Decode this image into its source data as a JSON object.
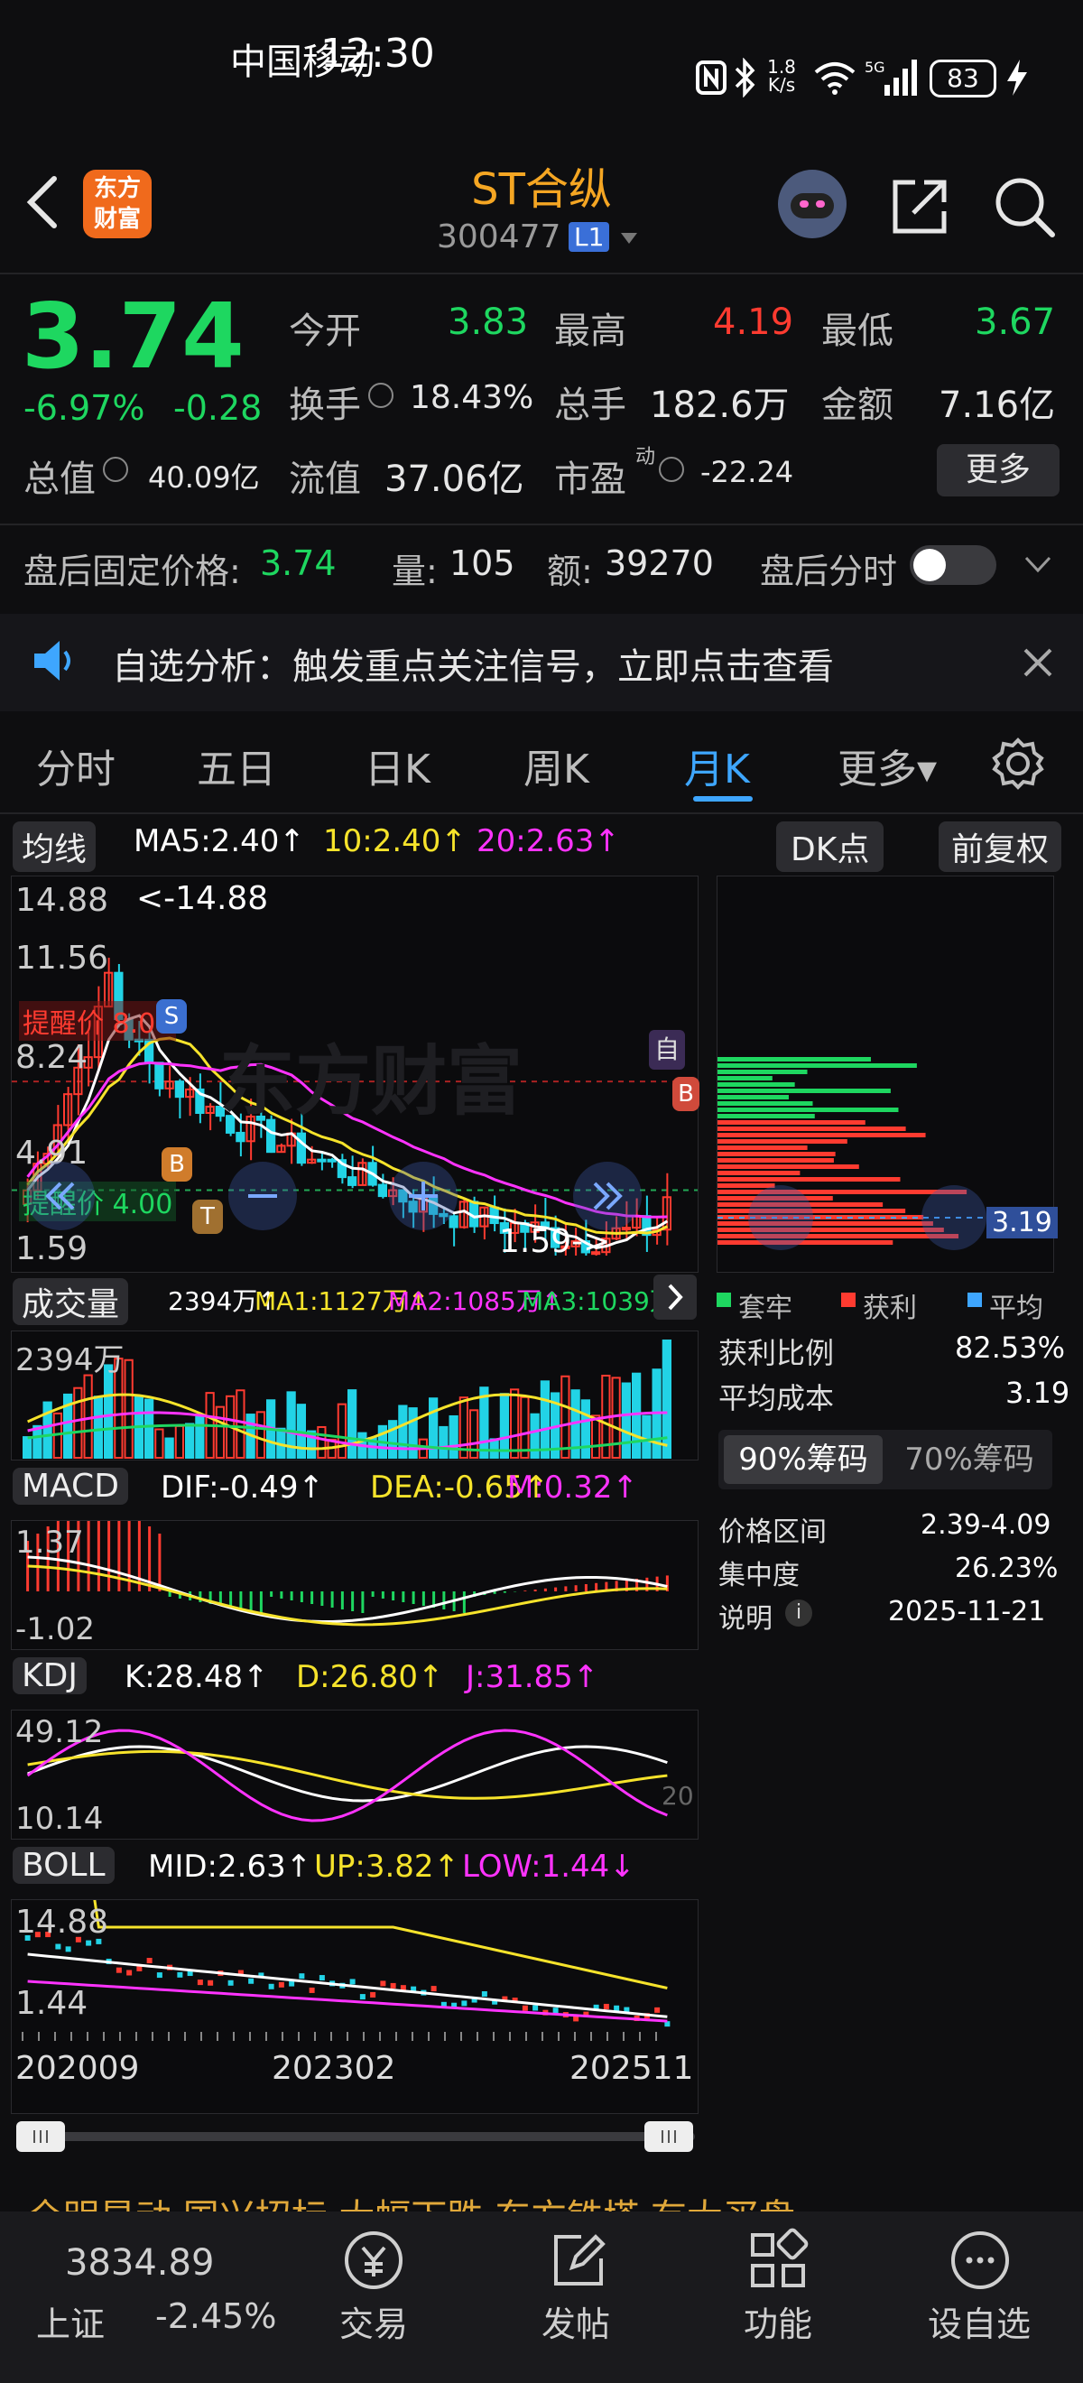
{
  "status_bar": {
    "carrier": "中国移动",
    "time": "12:30",
    "net_speed_top": "1.8",
    "net_speed_bottom": "K/s",
    "battery": "83"
  },
  "header": {
    "logo_line1": "东方",
    "logo_line2": "财富",
    "title": "ST合纵",
    "code": "300477",
    "level": "L1"
  },
  "quote": {
    "price": "3.74",
    "change_pct": "-6.97%",
    "change_abs": "-0.28",
    "open_label": "今开",
    "open": "3.83",
    "high_label": "最高",
    "high": "4.19",
    "low_label": "最低",
    "low": "3.67",
    "turnover_label": "换手",
    "turnover": "18.43%",
    "volume_label": "总手",
    "volume": "182.6万",
    "amount_label": "金额",
    "amount": "7.16亿",
    "mktcap_label": "总值",
    "mktcap": "40.09亿",
    "float_label": "流值",
    "float_cap": "37.06亿",
    "pe_label": "市盈",
    "pe_sup": "动",
    "pe": "-22.24",
    "more_btn": "更多"
  },
  "after_hours": {
    "label": "盘后固定价格:",
    "price": "3.74",
    "vol_label": "量:",
    "vol": "105",
    "amt_label": "额:",
    "amt": "39270",
    "toggle_label": "盘后分时"
  },
  "notice": {
    "text": "自选分析：触发重点关注信号，立即点击查看"
  },
  "tabs": [
    "分时",
    "五日",
    "日K",
    "周K",
    "月K",
    "更多▾"
  ],
  "active_tab": "月K",
  "main_chart": {
    "indicator": "均线",
    "ma5": "MA5:2.40↑",
    "ma10": "10:2.40↑",
    "ma20": "20:2.63↑",
    "dk_btn": "DK点",
    "fq_btn": "前复权",
    "y_labels": [
      "14.88",
      "11.56",
      "8.24",
      "4.91",
      "1.59"
    ],
    "max_marker": "<-14.88",
    "min_marker": "1.59->",
    "alert_high": "提醒价 8.00",
    "alert_low": "提醒价 4.00",
    "watermark": "东方财富",
    "self_tag": "自"
  },
  "volume_chart": {
    "indicator": "成交量",
    "val": "2394万↑",
    "ma1": "MA1:1127万↑",
    "ma2": "MA2:1085万↑",
    "ma3": "MA3:1039万↑",
    "y_top": "2394万"
  },
  "macd_chart": {
    "indicator": "MACD",
    "dif": "DIF:-0.49↑",
    "dea": "DEA:-0.65↑",
    "m": "M:0.32↑",
    "y_top": "1.37",
    "y_bottom": "-1.02"
  },
  "kdj_chart": {
    "indicator": "KDJ",
    "k": "K:28.48↑",
    "d": "D:26.80↑",
    "j": "J:31.85↑",
    "y_top": "49.12",
    "y_bottom": "10.14",
    "right_label": "20"
  },
  "boll_chart": {
    "indicator": "BOLL",
    "mid": "MID:2.63↑",
    "up": "UP:3.82↑",
    "low": "LOW:1.44↓",
    "y_top": "14.88",
    "y_bottom": "1.44"
  },
  "x_axis": [
    "202009",
    "202302",
    "202511"
  ],
  "chip_panel": {
    "avg_cost_tag": "3.19",
    "legend": [
      "套牢",
      "获利",
      "平均"
    ],
    "rows": [
      [
        "获利比例",
        "82.53%"
      ],
      [
        "平均成本",
        "3.19"
      ]
    ],
    "tab_active": "90%筹码",
    "tab_other": "70%筹码",
    "rows2": [
      [
        "价格区间",
        "2.39-4.09"
      ],
      [
        "集中度",
        "26.23%"
      ],
      [
        "说明",
        "2025-11-21"
      ]
    ]
  },
  "ticker": {
    "text": "全明星动 国兴招标 大幅下跌 东方铁塔 有大买盘"
  },
  "bottom_nav": {
    "index_value": "3834.89",
    "index_name": "上证",
    "index_change": "-2.45%",
    "items": [
      "交易",
      "发帖",
      "功能",
      "设自选"
    ]
  },
  "colors": {
    "up": "#ff3b30",
    "down": "#1ed760",
    "accent": "#3ea6ff",
    "bg": "#0e0e10"
  }
}
